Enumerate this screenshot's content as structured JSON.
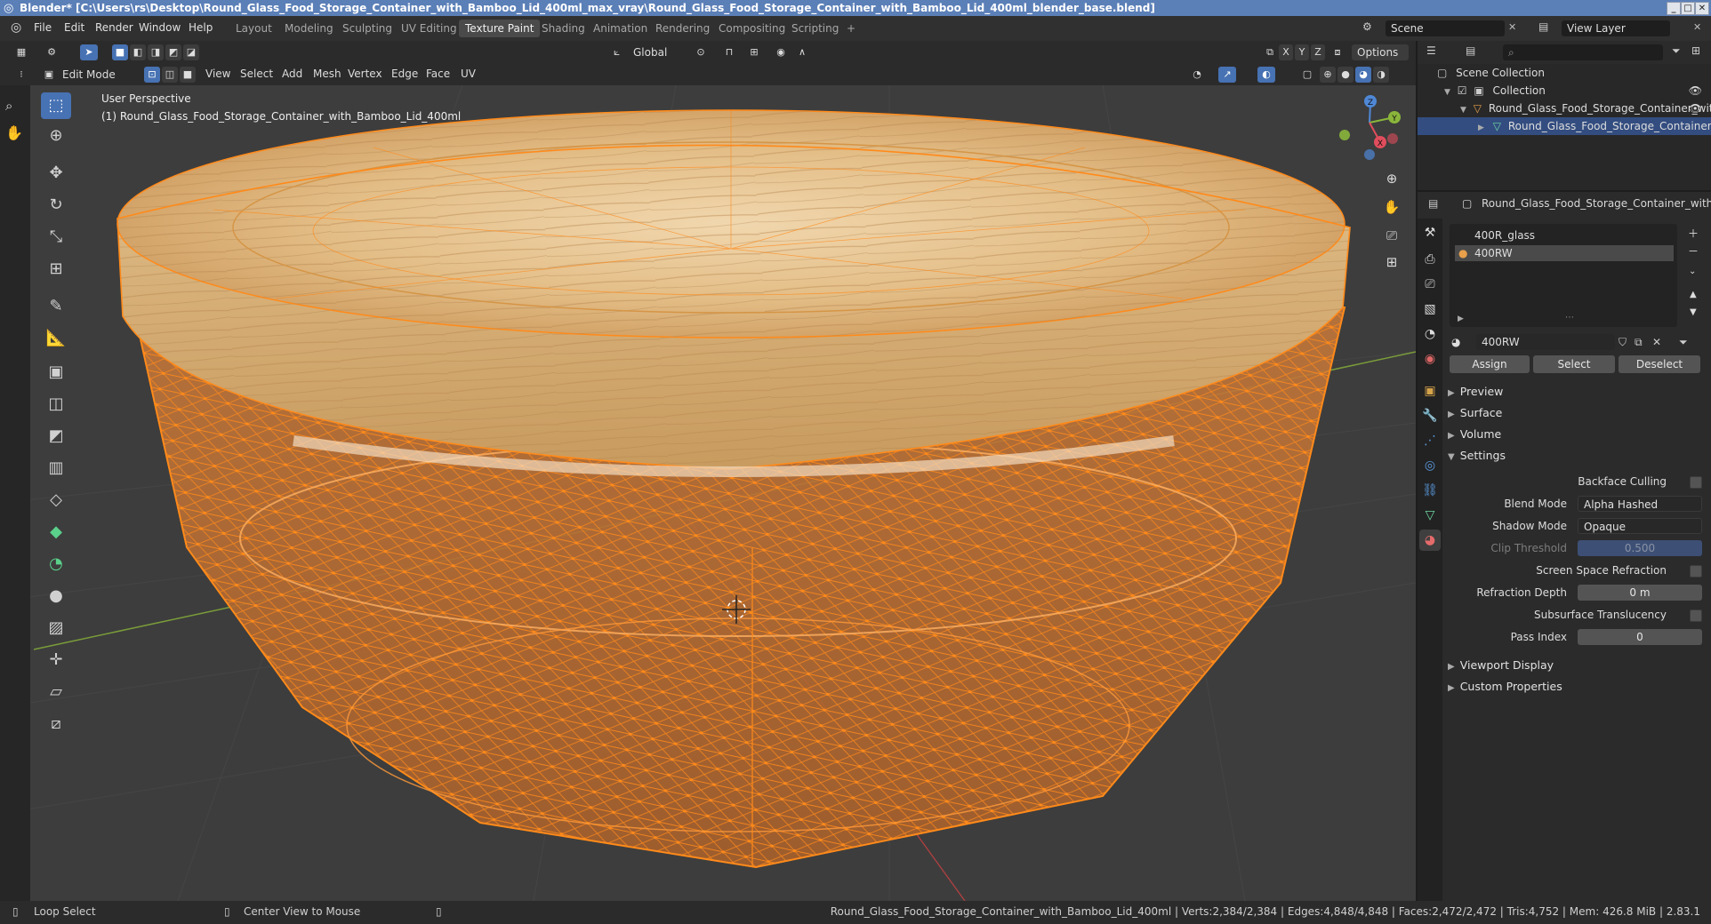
{
  "titlebar": {
    "title": "Blender* [C:\\Users\\rs\\Desktop\\Round_Glass_Food_Storage_Container_with_Bamboo_Lid_400ml_max_vray\\Round_Glass_Food_Storage_Container_with_Bamboo_Lid_400ml_blender_base.blend]",
    "minimize": "_",
    "maximize": "□",
    "close": "✕"
  },
  "menu": {
    "items": [
      "File",
      "Edit",
      "Render",
      "Window",
      "Help"
    ],
    "workspaces": [
      "Layout",
      "Modeling",
      "Sculpting",
      "UV Editing",
      "Texture Paint",
      "Shading",
      "Animation",
      "Rendering",
      "Compositing",
      "Scripting"
    ],
    "active_workspace": "Texture Paint",
    "add_tab": "+",
    "scene": "Scene",
    "view_layer": "View Layer"
  },
  "viewport_header": {
    "mode": "Edit Mode",
    "menus": [
      "View",
      "Select",
      "Add",
      "Mesh",
      "Vertex",
      "Edge",
      "Face",
      "UV"
    ],
    "transform_orientation": "Global",
    "axes": [
      "X",
      "Y",
      "Z"
    ],
    "options": "Options"
  },
  "viewport": {
    "perspective": "User Perspective",
    "object_info": "(1) Round_Glass_Food_Storage_Container_with_Bamboo_Lid_400ml",
    "gizmo_axes": [
      "Z",
      "Y",
      "X"
    ]
  },
  "statusbar": {
    "loop_select": "Loop Select",
    "center_view": "Center View to Mouse",
    "stats": "Round_Glass_Food_Storage_Container_with_Bamboo_Lid_400ml | Verts:2,384/2,384 | Edges:4,848/4,848 | Faces:2,472/2,472 | Tris:4,752 | Mem: 426.8 MiB | 2.83.1"
  },
  "outliner": {
    "scene_collection": "Scene Collection",
    "collection": "Collection",
    "object": "Round_Glass_Food_Storage_Container_with_",
    "mesh": "Round_Glass_Food_Storage_Container_w"
  },
  "properties": {
    "object_name": "Round_Glass_Food_Storage_Container_with_Bamboo",
    "material_slots": [
      "400R_glass",
      "400RW"
    ],
    "active_slot": "400RW",
    "material_name": "400RW",
    "buttons": {
      "assign": "Assign",
      "select": "Select",
      "deselect": "Deselect"
    },
    "sections": {
      "preview": "Preview",
      "surface": "Surface",
      "volume": "Volume",
      "settings": "Settings",
      "viewport_display": "Viewport Display",
      "custom_properties": "Custom Properties"
    },
    "settings": {
      "backface_culling_label": "Backface Culling",
      "blend_mode_label": "Blend Mode",
      "blend_mode": "Alpha Hashed",
      "shadow_mode_label": "Shadow Mode",
      "shadow_mode": "Opaque",
      "clip_threshold_label": "Clip Threshold",
      "clip_threshold": "0.500",
      "ssr_label": "Screen Space Refraction",
      "refraction_depth_label": "Refraction Depth",
      "refraction_depth": "0 m",
      "sss_label": "Subsurface Translucency",
      "pass_index_label": "Pass Index",
      "pass_index": "0"
    }
  },
  "colors": {
    "accent": "#4772b3",
    "selection_orange": "#ff8a1a",
    "wood_light": "#e9c79a",
    "wood_dark": "#b9874f",
    "viewport_bg": "#3d3d3d"
  }
}
